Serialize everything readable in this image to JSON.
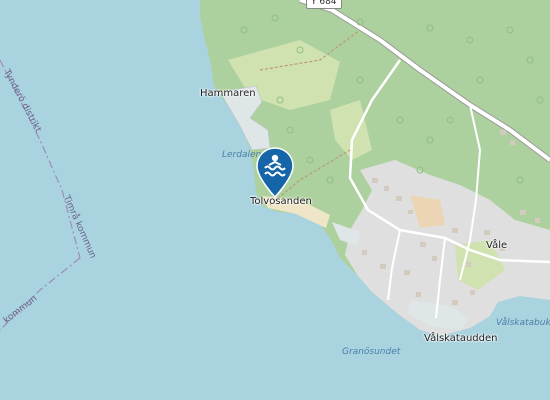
{
  "map": {
    "places": {
      "hammaren": "Hammaren",
      "tolvosanden": "Tolvosanden",
      "vale": "Våle",
      "valskataudden": "Vålskataudden"
    },
    "water": {
      "lerdalen": "Lerdalen",
      "granosundet": "Granösundet",
      "valskatabukta": "Vålskatabukta"
    },
    "boundaries": {
      "tyndero": "Tynderö distrikt",
      "timra": "Timrå kommun",
      "kommun_left": "kommun"
    },
    "road_ref": "Y 684",
    "poi": {
      "icon": "swimming-icon",
      "color": "#1565a8"
    },
    "colors": {
      "water": "#a9d3df",
      "forest": "#add19e",
      "land": "#f2efe9",
      "residential": "#e0dfdf",
      "farmland": "#e3e8c6"
    }
  }
}
